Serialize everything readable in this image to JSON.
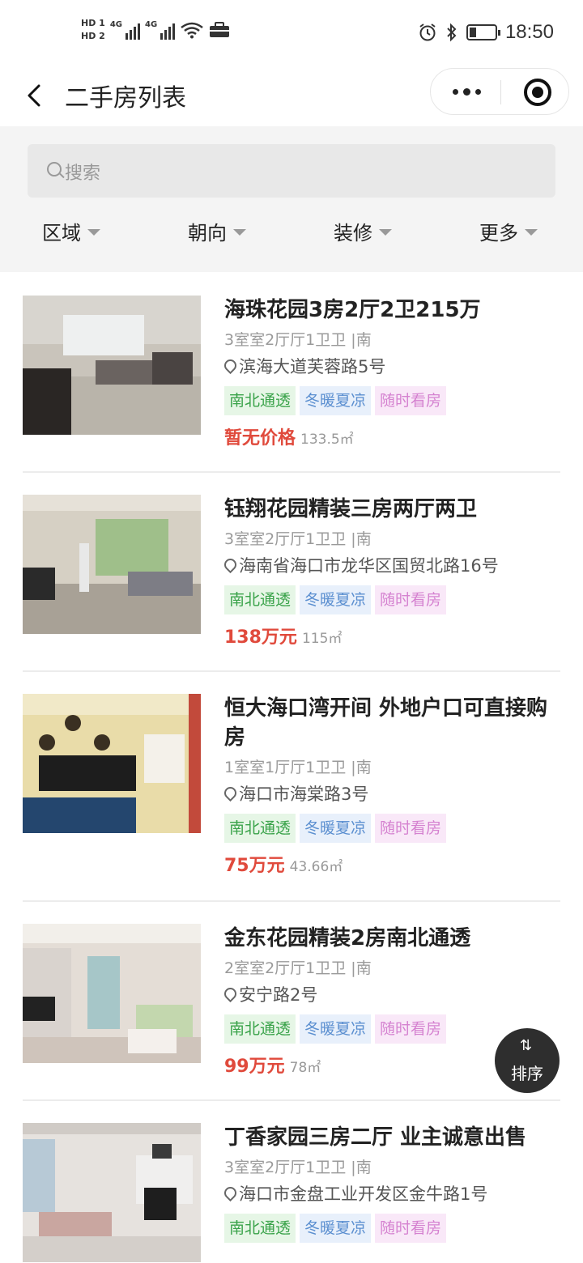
{
  "status_bar": {
    "sim1": "HD 1",
    "sim2": "HD 2",
    "net1": "4G",
    "net2": "4G",
    "time": "18:50"
  },
  "nav": {
    "title": "二手房列表"
  },
  "search": {
    "placeholder": "搜索"
  },
  "filters": [
    "区域",
    "朝向",
    "装修",
    "更多"
  ],
  "listings": [
    {
      "title": "海珠花园3房2厅2卫215万",
      "meta": "3室室2厅厅1卫卫 |南",
      "address": "滨海大道芙蓉路5号",
      "tags": [
        "南北通透",
        "冬暖夏凉",
        "随时看房"
      ],
      "price": "暂无价格",
      "area": "133.5㎡"
    },
    {
      "title": "钰翔花园精装三房两厅两卫",
      "meta": "3室室2厅厅1卫卫 |南",
      "address": "海南省海口市龙华区国贸北路16号",
      "tags": [
        "南北通透",
        "冬暖夏凉",
        "随时看房"
      ],
      "price": "138万元",
      "area": "115㎡"
    },
    {
      "title": "恒大海口湾开间 外地户口可直接购房",
      "meta": "1室室1厅厅1卫卫 |南",
      "address": "海口市海棠路3号",
      "tags": [
        "南北通透",
        "冬暖夏凉",
        "随时看房"
      ],
      "price": "75万元",
      "area": "43.66㎡"
    },
    {
      "title": "金东花园精装2房南北通透",
      "meta": "2室室2厅厅1卫卫 |南",
      "address": "安宁路2号",
      "tags": [
        "南北通透",
        "冬暖夏凉",
        "随时看房"
      ],
      "price": "99万元",
      "area": "78㎡"
    },
    {
      "title": "丁香家园三房二厅 业主诚意出售",
      "meta": "3室室2厅厅1卫卫 |南",
      "address": "海口市金盘工业开发区金牛路1号",
      "tags": [
        "南北通透",
        "冬暖夏凉",
        "随时看房"
      ],
      "price": "",
      "area": ""
    }
  ],
  "sort_button": {
    "label": "排序"
  }
}
